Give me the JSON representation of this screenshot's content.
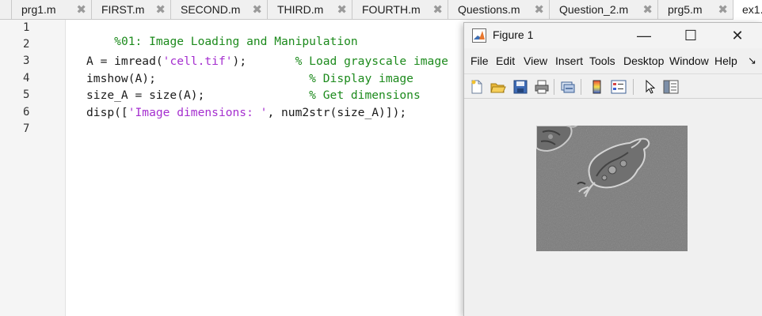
{
  "tabs": [
    {
      "label": "prg1.m",
      "close": "✖"
    },
    {
      "label": "FIRST.m",
      "close": "✖"
    },
    {
      "label": "SECOND.m",
      "close": "✖"
    },
    {
      "label": "THIRD.m",
      "close": "✖"
    },
    {
      "label": "FOURTH.m",
      "close": "✖"
    },
    {
      "label": "Questions.m",
      "close": "✖"
    },
    {
      "label": "Question_2.m",
      "close": "✖"
    },
    {
      "label": "prg5.m",
      "close": "✖"
    },
    {
      "label": "ex1."
    }
  ],
  "editor": {
    "line_numbers": [
      "1",
      "2",
      "3",
      "4",
      "5",
      "6",
      "7"
    ],
    "lines": {
      "l1": {
        "comment": "%01: Image Loading and Manipulation"
      },
      "l3": {
        "code_a": "A = imread(",
        "str": "'cell.tif'",
        "code_b": ");       ",
        "comment": "% Load grayscale image"
      },
      "l4": {
        "code": "imshow(A);                      ",
        "comment": "% Display image"
      },
      "l5": {
        "code": "size_A = size(A);               ",
        "comment": "% Get dimensions"
      },
      "l6": {
        "code_a": "disp([",
        "str": "'Image dimensions: '",
        "code_b": ", num2str(size_A)]);"
      }
    }
  },
  "figure": {
    "title": "Figure 1",
    "window_buttons": {
      "minimize": "—",
      "maximize": "☐",
      "close": "✕"
    },
    "menu": [
      "File",
      "Edit",
      "View",
      "Insert",
      "Tools",
      "Desktop",
      "Window",
      "Help"
    ],
    "menu_overflow": "↘",
    "toolbar_icons": [
      "new-figure-icon",
      "open-file-icon",
      "save-icon",
      "print-icon",
      "link-plot-icon",
      "colorbar-icon",
      "legend-icon",
      "pointer-icon",
      "property-editor-icon"
    ],
    "image_alt": "grayscale microscope image of cells"
  },
  "colors": {
    "comment": "#1c8a1c",
    "string": "#a52fcf",
    "matlab_orange": "#e8772e",
    "image_gray": "#7b7b7b"
  }
}
